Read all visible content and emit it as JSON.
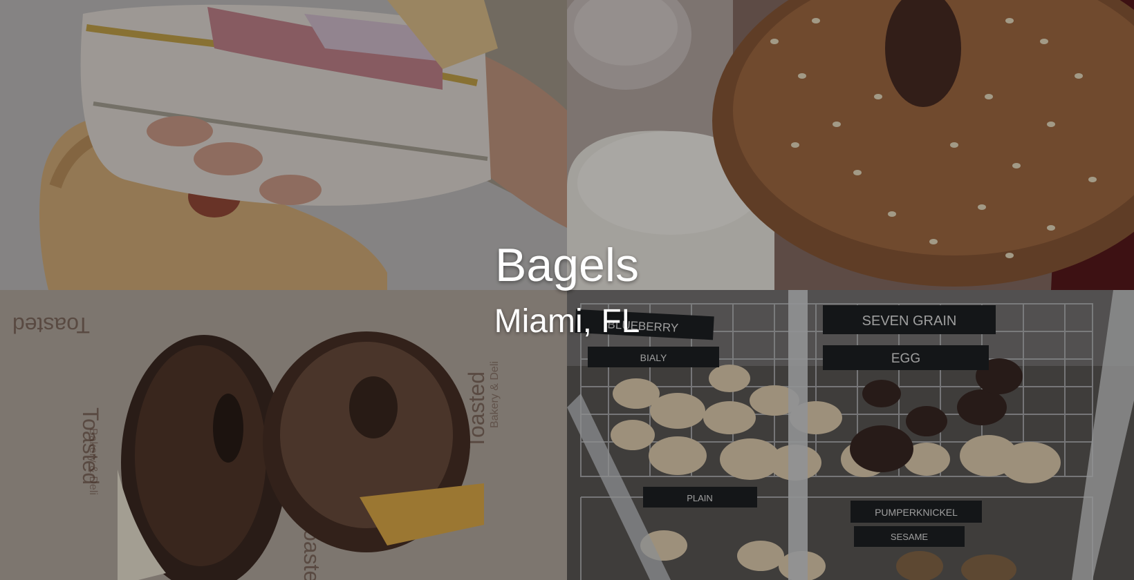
{
  "header": {
    "title": "Bagels",
    "location": "Miami, FL"
  },
  "photos": [
    {
      "name": "bagel-sandwich-photo"
    },
    {
      "name": "everything-bagel-photo"
    },
    {
      "name": "pumpernickel-bagel-photo",
      "paper_print": [
        "Toasted",
        "Bakery & Deli"
      ]
    },
    {
      "name": "bagel-display-case-photo",
      "signs": [
        "BLUEBERRY",
        "BIALY",
        "SEVEN GRAIN",
        "EGG",
        "PLAIN",
        "PUMPERKNICKEL",
        "SESAME"
      ]
    }
  ],
  "colors": {
    "overlay": "rgba(0,0,0,0.32)",
    "text": "#ffffff",
    "sign": "#1e2124"
  }
}
